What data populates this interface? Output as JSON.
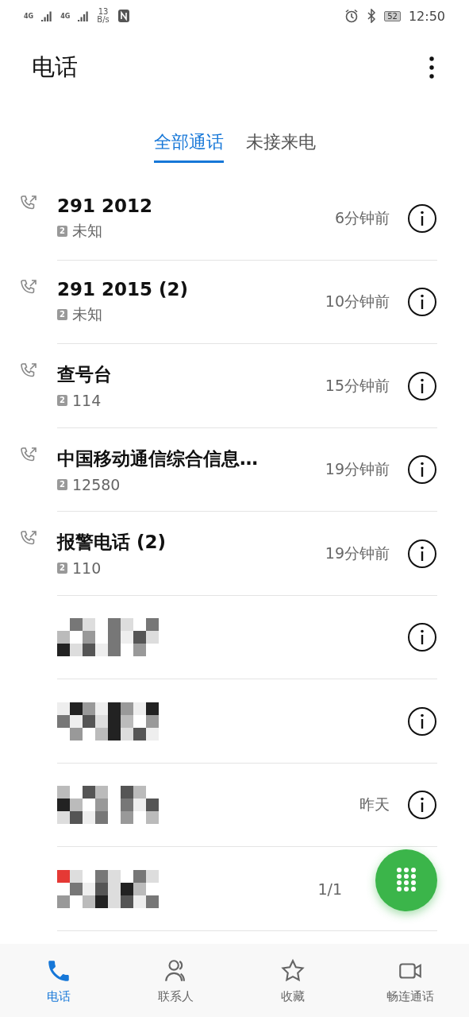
{
  "status_bar": {
    "signal_1": "4G",
    "signal_2": "4G",
    "speed": "13",
    "speed_unit": "B/s",
    "battery": "52",
    "time": "12:50"
  },
  "header": {
    "title": "电话"
  },
  "tabs": [
    {
      "label": "全部通话",
      "selected": true
    },
    {
      "label": "未接来电",
      "selected": false
    }
  ],
  "calls": [
    {
      "kind": "call",
      "name": "291 2012",
      "sim": "2",
      "number": "未知",
      "time": "6分钟前"
    },
    {
      "kind": "call",
      "name": "291 2015 (2)",
      "sim": "2",
      "number": "未知",
      "time": "10分钟前"
    },
    {
      "kind": "call",
      "name": "查号台",
      "sim": "2",
      "number": "114",
      "time": "15分钟前"
    },
    {
      "kind": "call",
      "name": "中国移动通信综合信息…",
      "sim": "2",
      "number": "12580",
      "time": "19分钟前"
    },
    {
      "kind": "call",
      "name": "报警电话 (2)",
      "sim": "2",
      "number": "110",
      "time": "19分钟前"
    },
    {
      "kind": "redacted"
    },
    {
      "kind": "redacted"
    },
    {
      "kind": "redacted",
      "time": "昨天"
    },
    {
      "kind": "redacted",
      "time": "1/1"
    }
  ],
  "nav": [
    {
      "label": "电话",
      "selected": true
    },
    {
      "label": "联系人",
      "selected": false
    },
    {
      "label": "收藏",
      "selected": false
    },
    {
      "label": "畅连通话",
      "selected": false
    }
  ]
}
